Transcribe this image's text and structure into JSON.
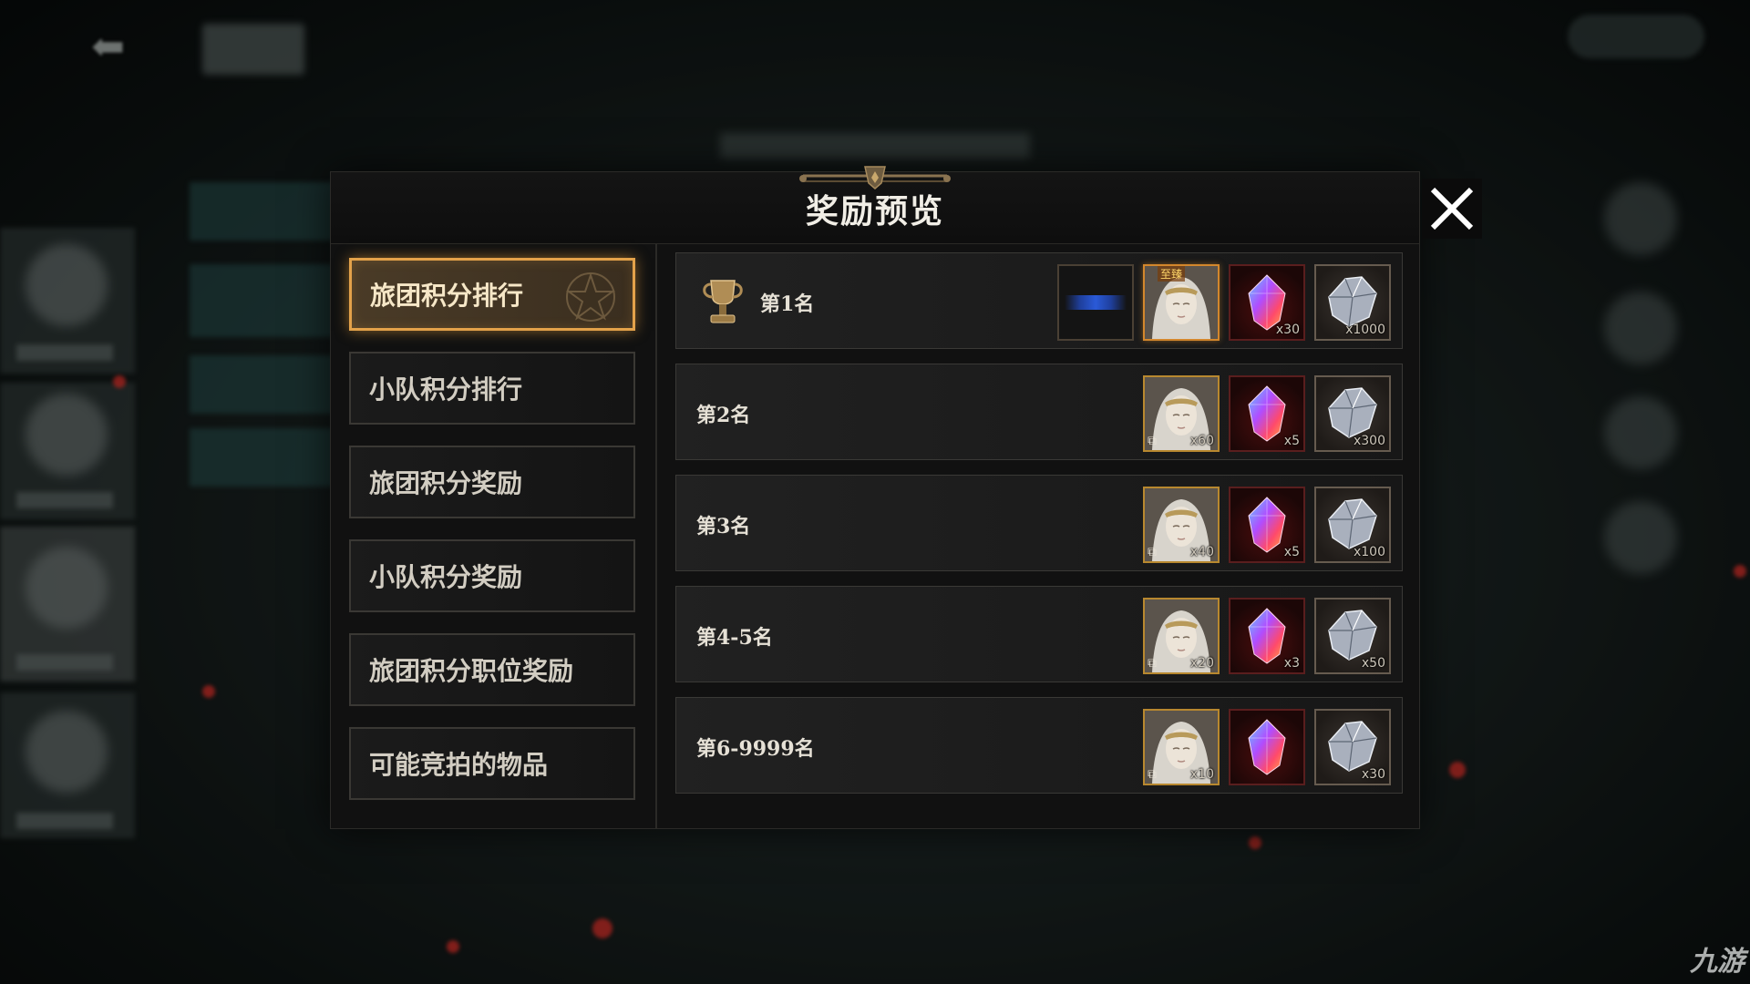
{
  "modal": {
    "title": "奖励预览"
  },
  "menu": {
    "items": [
      {
        "label": "旅团积分排行",
        "active": true
      },
      {
        "label": "小队积分排行",
        "active": false
      },
      {
        "label": "旅团积分奖励",
        "active": false
      },
      {
        "label": "小队积分奖励",
        "active": false
      },
      {
        "label": "旅团积分职位奖励",
        "active": false
      },
      {
        "label": "可能竞拍的物品",
        "active": false
      }
    ]
  },
  "ranks": [
    {
      "label": "第1名",
      "has_trophy": true,
      "rewards": [
        {
          "type": "title-plate",
          "icon": "title-plate-icon",
          "qty": ""
        },
        {
          "type": "portrait",
          "icon": "character-portrait-icon",
          "badge": "至臻",
          "qty": ""
        },
        {
          "type": "crystal",
          "icon": "prismatic-crystal-icon",
          "qty": "x30"
        },
        {
          "type": "diamond",
          "icon": "silver-diamond-icon",
          "qty": "x1000"
        }
      ]
    },
    {
      "label": "第2名",
      "rewards": [
        {
          "type": "portrait-fragment",
          "icon": "portrait-fragment-icon",
          "qty": "x60"
        },
        {
          "type": "crystal",
          "icon": "prismatic-crystal-icon",
          "qty": "x5"
        },
        {
          "type": "diamond",
          "icon": "silver-diamond-icon",
          "qty": "x300"
        }
      ]
    },
    {
      "label": "第3名",
      "rewards": [
        {
          "type": "portrait-fragment",
          "icon": "portrait-fragment-icon",
          "qty": "x40"
        },
        {
          "type": "crystal",
          "icon": "prismatic-crystal-icon",
          "qty": "x5"
        },
        {
          "type": "diamond",
          "icon": "silver-diamond-icon",
          "qty": "x100"
        }
      ]
    },
    {
      "label": "第4-5名",
      "rewards": [
        {
          "type": "portrait-fragment",
          "icon": "portrait-fragment-icon",
          "qty": "x20"
        },
        {
          "type": "crystal",
          "icon": "prismatic-crystal-icon",
          "qty": "x3"
        },
        {
          "type": "diamond",
          "icon": "silver-diamond-icon",
          "qty": "x50"
        }
      ]
    },
    {
      "label": "第6-9999名",
      "rewards": [
        {
          "type": "portrait-fragment",
          "icon": "portrait-fragment-icon",
          "qty": "x10"
        },
        {
          "type": "crystal",
          "icon": "prismatic-crystal-icon",
          "qty": ""
        },
        {
          "type": "diamond",
          "icon": "silver-diamond-icon",
          "qty": "x30"
        }
      ]
    }
  ],
  "watermark": "九游",
  "colors": {
    "accent": "#e3a24a",
    "panel": "#111111",
    "row": "#1f1f1f"
  }
}
